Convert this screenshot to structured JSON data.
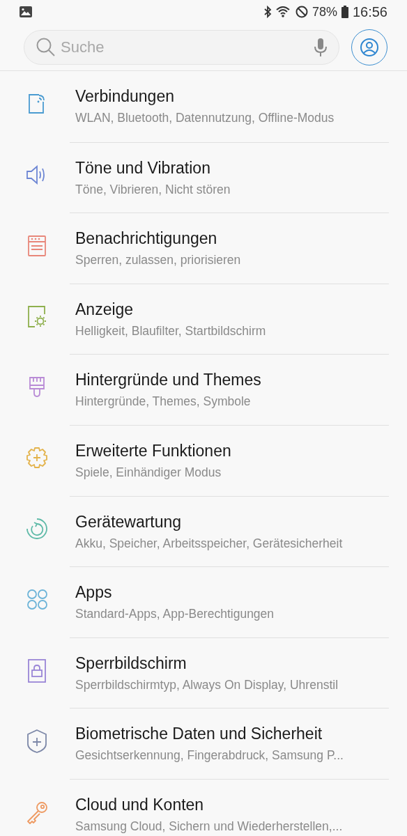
{
  "status_bar": {
    "battery": "78%",
    "time": "16:56"
  },
  "search": {
    "placeholder": "Suche"
  },
  "items": [
    {
      "title": "Verbindungen",
      "subtitle": "WLAN, Bluetooth, Datennutzung, Offline-Modus",
      "kind": "connections",
      "color": "#4a9bd1"
    },
    {
      "title": "Töne und Vibration",
      "subtitle": "Töne, Vibrieren, Nicht stören",
      "kind": "sound",
      "color": "#6d86d4"
    },
    {
      "title": "Benachrichtigungen",
      "subtitle": "Sperren, zulassen, priorisieren",
      "kind": "notifications",
      "color": "#e8877a"
    },
    {
      "title": "Anzeige",
      "subtitle": "Helligkeit, Blaufilter, Startbildschirm",
      "kind": "display",
      "color": "#8fb04e"
    },
    {
      "title": "Hintergründe und Themes",
      "subtitle": "Hintergründe, Themes, Symbole",
      "kind": "brush",
      "color": "#b98bd6"
    },
    {
      "title": "Erweiterte Funktionen",
      "subtitle": "Spiele, Einhändiger Modus",
      "kind": "gearplus",
      "color": "#e3b34c"
    },
    {
      "title": "Gerätewartung",
      "subtitle": "Akku, Speicher, Arbeitsspeicher, Gerätesicherheit",
      "kind": "maintenance",
      "color": "#5fbaa8"
    },
    {
      "title": "Apps",
      "subtitle": "Standard-Apps, App-Berechtigungen",
      "kind": "apps",
      "color": "#6db4d8"
    },
    {
      "title": "Sperrbildschirm",
      "subtitle": "Sperrbildschirmtyp, Always On Display, Uhrenstil",
      "kind": "lock",
      "color": "#9a86d6"
    },
    {
      "title": "Biometrische Daten und Sicherheit",
      "subtitle": "Gesichtserkennung, Fingerabdruck, Samsung P...",
      "kind": "shield",
      "color": "#7d88a8"
    },
    {
      "title": "Cloud und Konten",
      "subtitle": "Samsung Cloud, Sichern und Wiederherstellen,...",
      "kind": "key",
      "color": "#ee9a62"
    }
  ]
}
